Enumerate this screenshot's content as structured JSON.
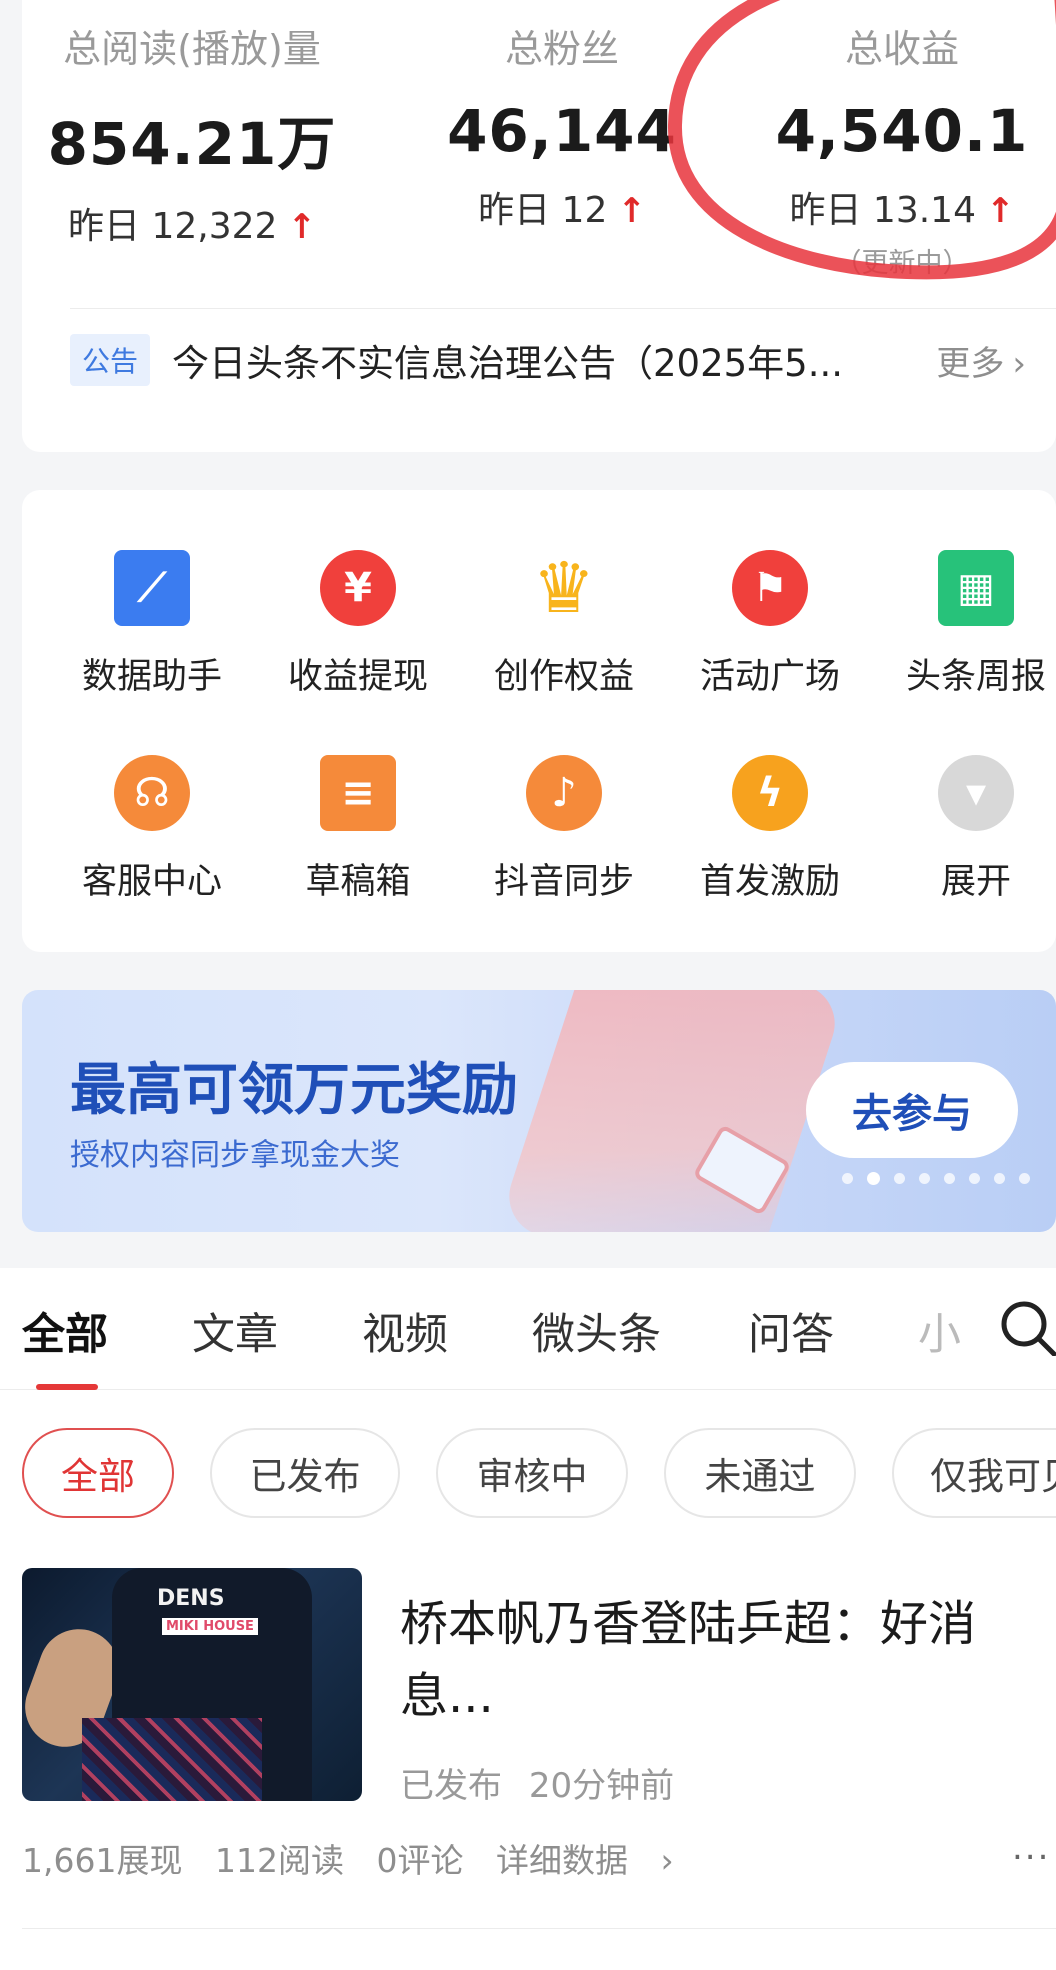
{
  "stats": {
    "reads": {
      "label": "总阅读(播放)量",
      "value": "854.21万",
      "yesterday": "昨日 12,322"
    },
    "fans": {
      "label": "总粉丝",
      "value": "46,144",
      "yesterday": "昨日 12"
    },
    "income": {
      "label": "总收益",
      "value": "4,540.1",
      "yesterday": "昨日 13.14",
      "note": "（更新中）"
    },
    "up_arrow": "↑"
  },
  "notice": {
    "tag": "公告",
    "text": "今日头条不实信息治理公告（2025年5...",
    "more": "更多",
    "chevron": "›"
  },
  "tools": [
    {
      "label": "数据助手",
      "icon": "chart-icon",
      "color": "#3b7cf0",
      "glyph": "📈"
    },
    {
      "label": "收益提现",
      "icon": "yuan-icon",
      "color": "#f0403c",
      "glyph": "¥"
    },
    {
      "label": "创作权益",
      "icon": "crown-icon",
      "color": "#f8b41c",
      "glyph": "♛"
    },
    {
      "label": "活动广场",
      "icon": "flag-icon",
      "color": "#f0403c",
      "glyph": "⚑"
    },
    {
      "label": "头条周报",
      "icon": "calendar-icon",
      "color": "#27c27a",
      "glyph": "▦"
    },
    {
      "label": "客服中心",
      "icon": "headset-icon",
      "color": "#f58a3a",
      "glyph": "☊"
    },
    {
      "label": "草稿箱",
      "icon": "draft-icon",
      "color": "#f58a3a",
      "glyph": "≡"
    },
    {
      "label": "抖音同步",
      "icon": "douyin-icon",
      "color": "#f58a3a",
      "glyph": "♪"
    },
    {
      "label": "首发激励",
      "icon": "lightning-icon",
      "color": "#f7a21e",
      "glyph": "ϟ"
    },
    {
      "label": "展开",
      "icon": "expand-icon",
      "color": "#d8d8d8",
      "glyph": "▾"
    }
  ],
  "banner": {
    "title": "最高可领万元奖励",
    "subtitle": "授权内容同步拿现金大奖",
    "cta": "去参与"
  },
  "tabs": [
    "全部",
    "文章",
    "视频",
    "微头条",
    "问答",
    "小"
  ],
  "filters": [
    "全部",
    "已发布",
    "审核中",
    "未通过",
    "仅我可见"
  ],
  "article": {
    "title": "桥本帆乃香登陆乒超：好消息...",
    "status": "已发布",
    "time": "20分钟前",
    "thumb_text1": "DENS",
    "thumb_text2": "MIKI HOUSE",
    "impressions": "1,661展现",
    "reads": "112阅读",
    "comments": "0评论",
    "details": "详细数据",
    "details_chevron": "›",
    "more": "..."
  }
}
